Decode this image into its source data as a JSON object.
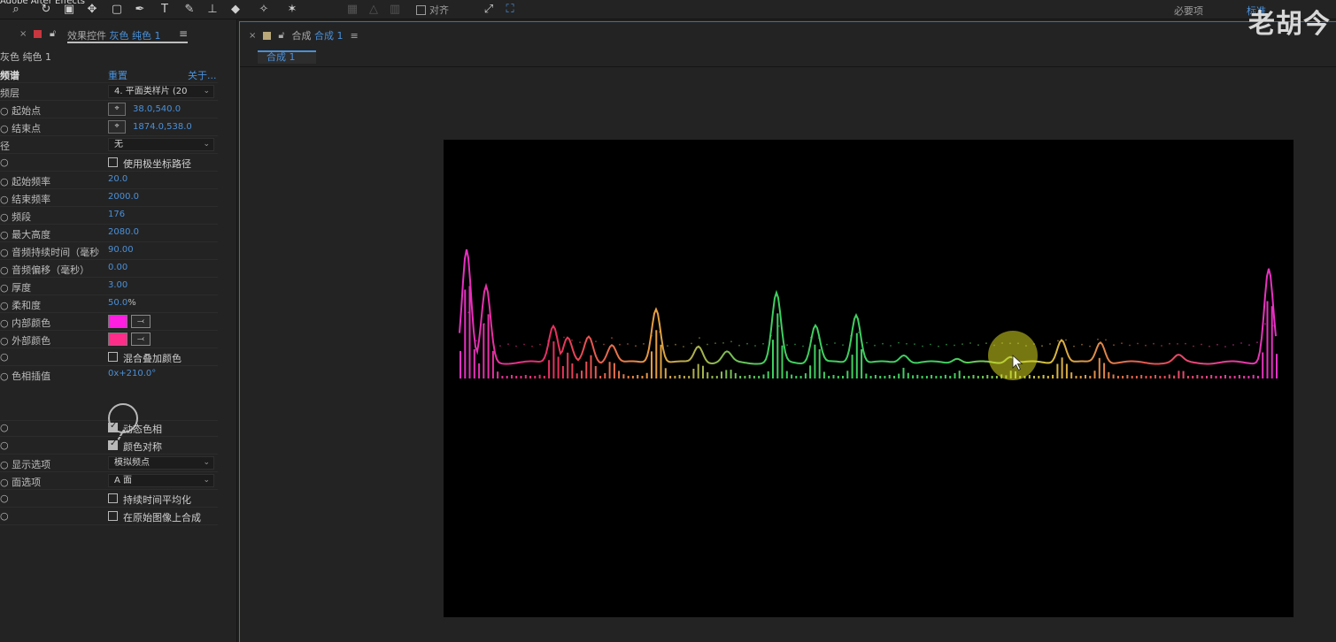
{
  "toolbar": {
    "title": "Adobe After Effects",
    "snap_label": "对齐",
    "workspace_label": "必要项",
    "workspace_active": "标准"
  },
  "effect_panel": {
    "tab_prefix": "效果控件",
    "tab_layer": "灰色 纯色 1",
    "layer_name": "灰色 纯色 1",
    "effect_name": "频谱",
    "reset": "重置",
    "about": "关于...",
    "rows": {
      "audio_layer_label": "频层",
      "audio_layer_value": "4. 平面类样片 (20",
      "start_point_label": "起始点",
      "start_point_value": "38.0,540.0",
      "end_point_label": "结束点",
      "end_point_value": "1874.0,538.0",
      "path_label": "径",
      "path_value": "无",
      "polar_label": "使用极坐标路径",
      "start_freq_label": "起始频率",
      "start_freq_value": "20.0",
      "end_freq_label": "结束频率",
      "end_freq_value": "2000.0",
      "bands_label": "频段",
      "bands_value": "176",
      "max_height_label": "最大高度",
      "max_height_value": "2080.0",
      "duration_label": "音频持续时间（毫秒",
      "duration_value": "90.00",
      "offset_label": "音频偏移（毫秒）",
      "offset_value": "0.00",
      "thickness_label": "厚度",
      "thickness_value": "3.00",
      "softness_label": "柔和度",
      "softness_value": "50.0",
      "softness_unit": "%",
      "inside_color_label": "内部颜色",
      "outside_color_label": "外部颜色",
      "blend_label": "混合叠加颜色",
      "hue_label": "色相插值",
      "hue_value": "0x+210.0°",
      "dynamic_hue_label": "动态色相",
      "color_sym_label": "颜色对称",
      "display_label": "显示选项",
      "display_value": "模拟频点",
      "side_label": "面选项",
      "side_value": "A 面",
      "avg_label": "持续时间平均化",
      "composite_label": "在原始图像上合成"
    },
    "colors": {
      "inside": "#ff1fe0",
      "outside": "#ff2d8a"
    }
  },
  "comp_panel": {
    "tab_prefix": "合成",
    "tab_name": "合成 1",
    "sub_tab": "合成 1"
  },
  "watermark": "老胡今"
}
